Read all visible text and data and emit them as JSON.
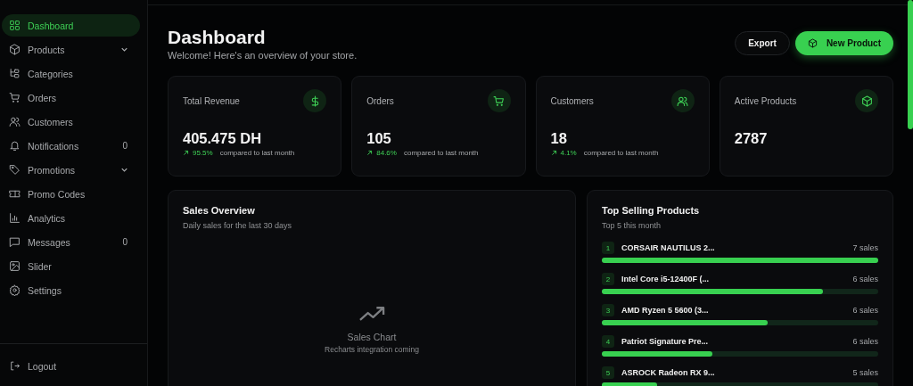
{
  "sidebar": {
    "items": [
      {
        "label": "Dashboard",
        "selected": true,
        "kind": "link"
      },
      {
        "label": "Products",
        "selected": false,
        "kind": "group"
      },
      {
        "label": "Categories",
        "selected": false,
        "kind": "link"
      },
      {
        "label": "Orders",
        "selected": false,
        "kind": "link"
      },
      {
        "label": "Customers",
        "selected": false,
        "kind": "link"
      },
      {
        "label": "Notifications",
        "selected": false,
        "kind": "link",
        "badge": "0"
      },
      {
        "label": "Promotions",
        "selected": false,
        "kind": "group"
      },
      {
        "label": "Promo Codes",
        "selected": false,
        "kind": "link"
      },
      {
        "label": "Analytics",
        "selected": false,
        "kind": "link"
      },
      {
        "label": "Messages",
        "selected": false,
        "kind": "link",
        "badge": "0"
      },
      {
        "label": "Slider",
        "selected": false,
        "kind": "link"
      },
      {
        "label": "Settings",
        "selected": false,
        "kind": "link"
      }
    ],
    "logout": "Logout"
  },
  "header": {
    "title": "Dashboard",
    "subtitle": "Welcome! Here's an overview of your store.",
    "buttons": [
      {
        "label": "Export",
        "kind": "secondary"
      },
      {
        "label": "New Product",
        "kind": "primary"
      }
    ]
  },
  "stats": [
    {
      "label": "Total Revenue",
      "value": "405.475 DH",
      "change": "95.5%",
      "note": "compared to last month"
    },
    {
      "label": "Orders",
      "value": "105",
      "change": "84.6%",
      "note": "compared to last month"
    },
    {
      "label": "Customers",
      "value": "18",
      "change": "4.1%",
      "note": "compared to last month"
    },
    {
      "label": "Active Products",
      "value": "2787"
    }
  ],
  "sales_overview": {
    "title": "Sales Overview",
    "subtitle": "Daily sales for the last 30 days",
    "placeholder_title": "Sales Chart",
    "placeholder_note": "Recharts integration coming"
  },
  "top_products": {
    "title": "Top Selling Products",
    "subtitle": "Top 5 this month",
    "items": [
      {
        "rank": "1",
        "name": "CORSAIR NAUTILUS 2...",
        "sales": "7 sales",
        "level": 1
      },
      {
        "rank": "2",
        "name": "Intel Core i5-12400F (...",
        "sales": "6 sales",
        "level": 0.8
      },
      {
        "rank": "3",
        "name": "AMD Ryzen 5 5600 (3...",
        "sales": "6 sales",
        "level": 0.6
      },
      {
        "rank": "4",
        "name": "Patriot Signature Pre...",
        "sales": "6 sales",
        "level": 0.4
      },
      {
        "rank": "5",
        "name": "ASROCK Radeon RX 9...",
        "sales": "5 sales",
        "level": 0.2
      }
    ]
  }
}
